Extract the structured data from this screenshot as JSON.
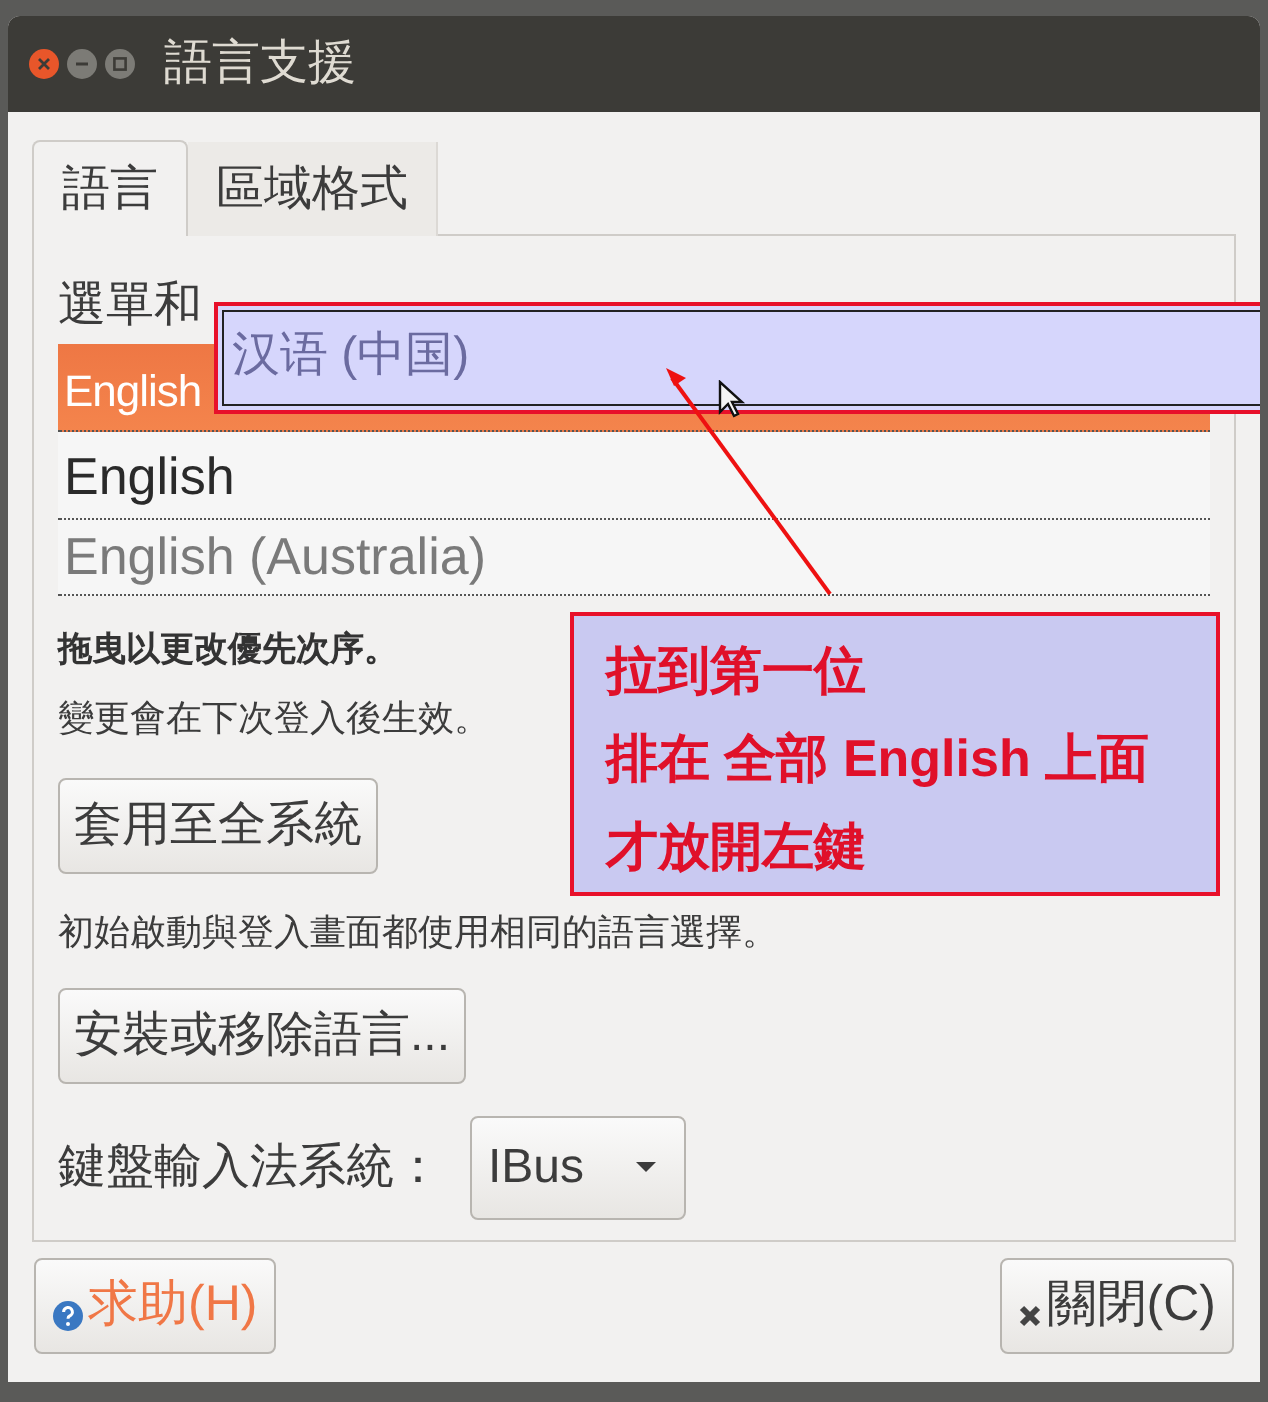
{
  "window": {
    "title": "語言支援"
  },
  "tabs": [
    {
      "label": "語言",
      "selected": true
    },
    {
      "label": "區域格式",
      "selected": false
    }
  ],
  "language_section": {
    "label": "選單和",
    "languages": [
      {
        "name": "English",
        "selected": true
      },
      {
        "name": "English",
        "selected": false
      },
      {
        "name": "English (Australia)",
        "selected": false
      }
    ],
    "drag_item": "汉语 (中国)",
    "hint_bold": "拖曳以更改優先次序。",
    "hint": "變更會在下次登入後生效。"
  },
  "apply_button": "套用至全系統",
  "apply_note": "初始啟動與登入畫面都使用相同的語言選擇。",
  "install_button": "安裝或移除語言...",
  "input_method": {
    "label": "鍵盤輸入法系統：",
    "value": "IBus"
  },
  "buttons": [
    {
      "kind": "help",
      "label": "求助(H)"
    },
    {
      "kind": "close",
      "label": "關閉(C)"
    }
  ],
  "annotation": {
    "lines": [
      "拉到第一位",
      "排在 全部 English 上面",
      "才放開左鍵"
    ]
  }
}
